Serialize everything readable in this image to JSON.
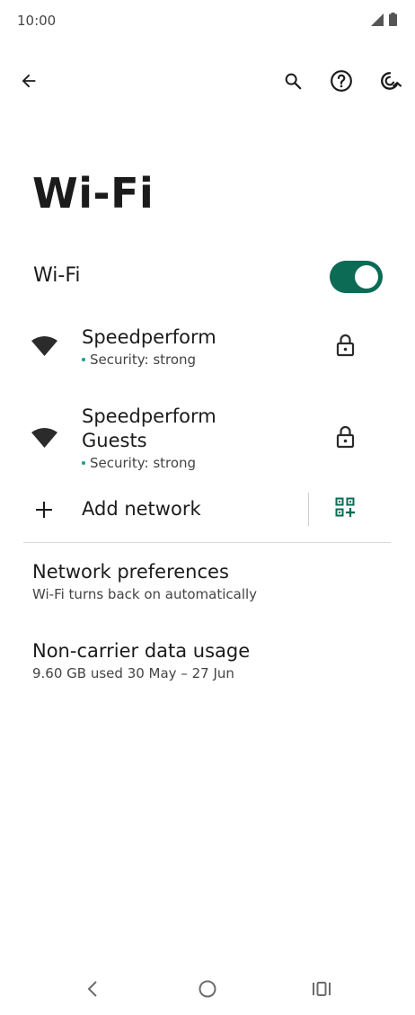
{
  "status_bar": {
    "time": "10:00"
  },
  "toolbar": {
    "back_icon": "arrow-left-icon",
    "search_icon": "search-icon",
    "help_icon": "help-icon",
    "refresh_icon": "refresh-icon"
  },
  "page": {
    "title": "Wi-Fi"
  },
  "wifi_toggle": {
    "label": "Wi-Fi",
    "state": "on",
    "accent": "#0b6b55"
  },
  "networks": [
    {
      "name": "Speedperform",
      "security": "Security: strong"
    },
    {
      "name": "Speedperform Guests",
      "security": "Security: strong"
    }
  ],
  "add_network": {
    "label": "Add network"
  },
  "preferences": {
    "title": "Network preferences",
    "subtitle": "Wi-Fi turns back on automatically"
  },
  "data_usage": {
    "title": "Non-carrier data usage",
    "subtitle": "9.60 GB used 30 May – 27 Jun"
  }
}
